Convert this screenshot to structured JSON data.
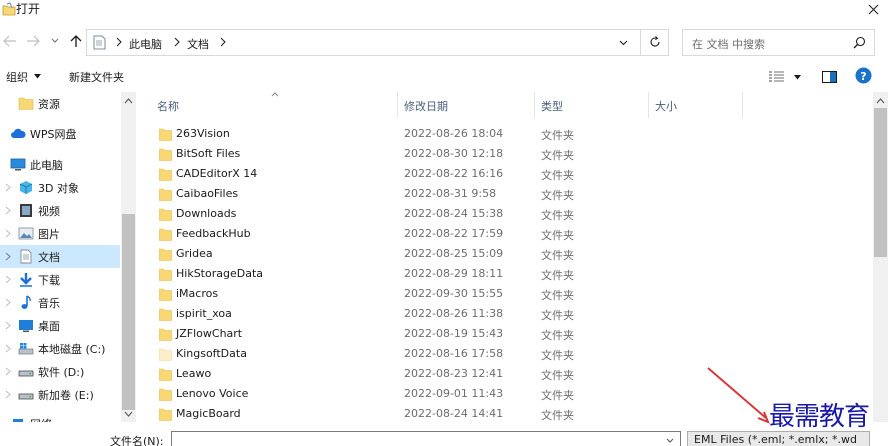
{
  "window": {
    "title": "打开"
  },
  "address": {
    "crumbs": [
      "此电脑",
      "文档"
    ]
  },
  "search": {
    "placeholder": "在 文档 中搜索"
  },
  "toolbar": {
    "organize": "组织",
    "new_folder": "新建文件夹"
  },
  "sidebar": {
    "items": [
      {
        "label": "资源",
        "icon": "folder-icon"
      },
      {
        "label": "WPS网盘",
        "icon": "cloud-icon"
      },
      {
        "label": "此电脑",
        "icon": "computer-icon"
      },
      {
        "label": "3D 对象",
        "icon": "cube-icon"
      },
      {
        "label": "视频",
        "icon": "video-icon"
      },
      {
        "label": "图片",
        "icon": "pictures-icon"
      },
      {
        "label": "文档",
        "icon": "document-icon",
        "selected": true
      },
      {
        "label": "下载",
        "icon": "download-icon"
      },
      {
        "label": "音乐",
        "icon": "music-icon"
      },
      {
        "label": "桌面",
        "icon": "desktop-icon"
      },
      {
        "label": "本地磁盘 (C:)",
        "icon": "drive-icon"
      },
      {
        "label": "软件 (D:)",
        "icon": "drive-icon"
      },
      {
        "label": "新加卷 (E:)",
        "icon": "drive-icon"
      },
      {
        "label": "网络",
        "icon": "network-icon"
      }
    ]
  },
  "list": {
    "columns": [
      "名称",
      "修改日期",
      "类型",
      "大小"
    ],
    "rows": [
      {
        "name": "263Vision",
        "date": "2022-08-26 18:04",
        "type": "文件夹"
      },
      {
        "name": "BitSoft Files",
        "date": "2022-08-30 12:18",
        "type": "文件夹"
      },
      {
        "name": "CADEditorX 14",
        "date": "2022-08-22 16:16",
        "type": "文件夹"
      },
      {
        "name": "CaibaoFiles",
        "date": "2022-08-31 9:58",
        "type": "文件夹"
      },
      {
        "name": "Downloads",
        "date": "2022-08-24 15:38",
        "type": "文件夹"
      },
      {
        "name": "FeedbackHub",
        "date": "2022-08-22 17:59",
        "type": "文件夹"
      },
      {
        "name": "Gridea",
        "date": "2022-08-25 15:09",
        "type": "文件夹"
      },
      {
        "name": "HikStorageData",
        "date": "2022-08-29 18:11",
        "type": "文件夹"
      },
      {
        "name": "iMacros",
        "date": "2022-09-30 15:55",
        "type": "文件夹"
      },
      {
        "name": "ispirit_xoa",
        "date": "2022-08-26 11:38",
        "type": "文件夹"
      },
      {
        "name": "JZFlowChart",
        "date": "2022-08-19 15:43",
        "type": "文件夹"
      },
      {
        "name": "KingsoftData",
        "date": "2022-08-16 17:58",
        "type": "文件夹",
        "faded": true
      },
      {
        "name": "Leawo",
        "date": "2022-08-23 12:41",
        "type": "文件夹"
      },
      {
        "name": "Lenovo Voice",
        "date": "2022-09-01 11:43",
        "type": "文件夹"
      },
      {
        "name": "MagicBoard",
        "date": "2022-08-24 14:41",
        "type": "文件夹"
      }
    ]
  },
  "bottom": {
    "filename_label": "文件名(N):",
    "filename_value": "",
    "filter": "EML Files (*.eml; *.emlx; *.wd"
  },
  "watermark": "最需教育",
  "colors": {
    "folder": "#f8d775",
    "folder_dark": "#e8b94a",
    "accent": "#0078d7",
    "selected": "#cce8ff"
  }
}
